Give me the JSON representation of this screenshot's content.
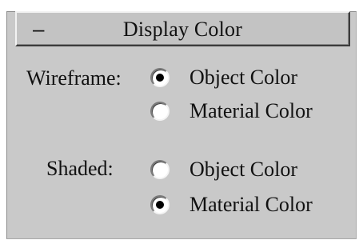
{
  "rollout": {
    "collapse_glyph": "–",
    "title": "Display Color"
  },
  "wireframe": {
    "label": "Wireframe:",
    "options": [
      {
        "label": "Object Color",
        "selected": true
      },
      {
        "label": "Material Color",
        "selected": false
      }
    ]
  },
  "shaded": {
    "label": "Shaded:",
    "options": [
      {
        "label": "Object Color",
        "selected": false
      },
      {
        "label": "Material Color",
        "selected": true
      }
    ]
  },
  "colors": {
    "panel_bg": "#c9c9c9",
    "text": "#111111",
    "radio_fill": "#ffffff",
    "radio_dot": "#000000"
  }
}
